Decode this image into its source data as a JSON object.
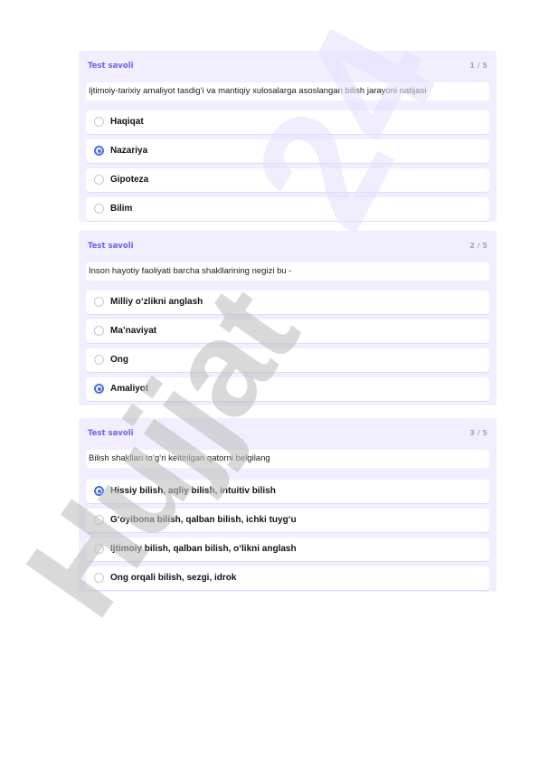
{
  "questions": [
    {
      "title": "Test savoli",
      "counter": "1 / 5",
      "text": "Ijtimoiy-tarixiy amaliyot  tasdig‘i va mantiqiy xulosalarga asoslangan bilish jarayoni natijasi",
      "options": [
        "Haqiqat",
        "Nazariya",
        "Gipoteza",
        "Bilim"
      ],
      "selected_option": "Nazariya"
    },
    {
      "title": "Test savoli",
      "counter": "2 / 5",
      "text": "Inson hayotiy faoliyati barcha shakllarining negizi bu -",
      "options": [
        "Milliy o‘zlikni anglash",
        "Ma’naviyat",
        "Ong",
        "Amaliyot"
      ],
      "selected_option": "Amaliyot"
    },
    {
      "title": "Test savoli",
      "counter": "3 / 5",
      "text": "Bilish shakllari to‘g‘ri keltirilgan qatorni belgilang",
      "options": [
        "Hissiy bilish, aqliy bilish, intuitiv bilish",
        "G‘oyibona bilish, qalban bilish, ichki tuyg‘u",
        "Ijtimoiy bilish, qalban bilish, o‘likni anglash",
        "Ong orqali bilish, sezgi, idrok"
      ],
      "selected_option": "Hissiy bilish, aqliy bilish, intuitiv bilish"
    }
  ],
  "watermark": {
    "brand": "Hujjat",
    "number": "24",
    "brand_color": "#c0c0c0",
    "number_color": "#e6e0ff"
  },
  "colors": {
    "card_background": "#f1efff",
    "title": "#6b63e8",
    "radio_selected": "#4a6fe0"
  }
}
